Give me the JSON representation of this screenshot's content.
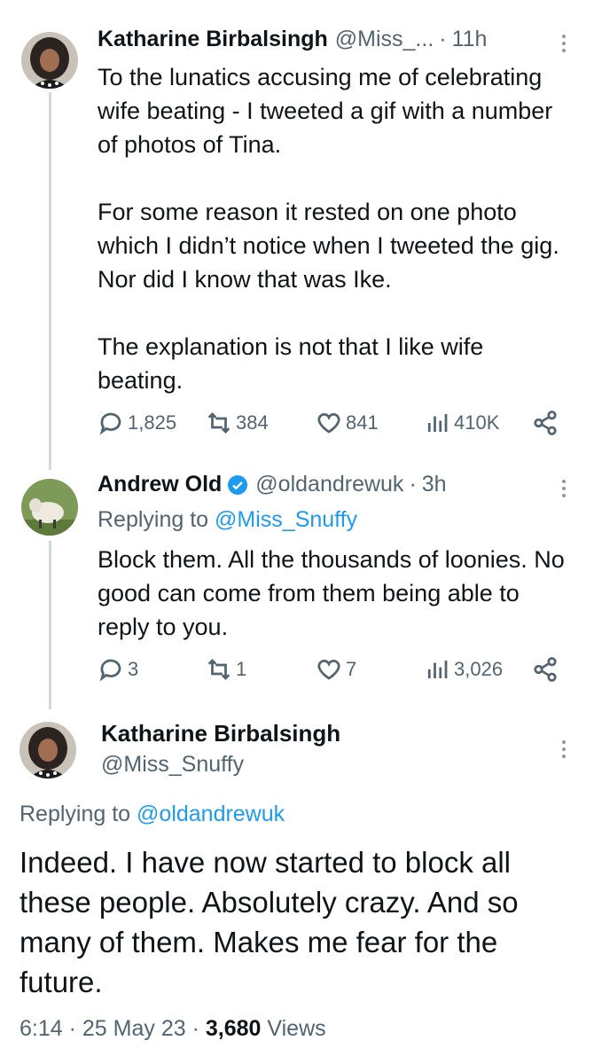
{
  "tweets": [
    {
      "name": "Katharine Birbalsingh",
      "handle": "@Miss_...",
      "time": "11h",
      "paragraphs": [
        "To the lunatics accusing me of celebrating wife beating - I tweeted a gif with a number of photos of Tina.",
        "For some reason it rested on one photo which I didn’t notice when I tweeted the gig. Nor did I know that was Ike.",
        "The explanation is not that I like wife beating."
      ],
      "actions": {
        "replies": "1,825",
        "retweets": "384",
        "likes": "841",
        "views": "410K"
      }
    },
    {
      "name": "Andrew Old",
      "handle": "@oldandrewuk",
      "time": "3h",
      "replying_label": "Replying to",
      "replying_to": "@Miss_Snuffy",
      "paragraphs": [
        "Block them. All the thousands of loonies. No good can come from them being able to reply to you."
      ],
      "actions": {
        "replies": "3",
        "retweets": "1",
        "likes": "7",
        "views": "3,026"
      }
    },
    {
      "name": "Katharine Birbalsingh",
      "handle": "@Miss_Snuffy",
      "replying_label": "Replying to",
      "replying_to": "@oldandrewuk",
      "text": "Indeed. I have now started to block all these people. Absolutely crazy. And so many of them. Makes me fear for the future.",
      "time": "6:14",
      "date": "25 May 23",
      "views_count": "3,680",
      "views_label": "Views"
    }
  ],
  "icons": [
    "reply-icon",
    "retweet-icon",
    "like-icon",
    "views-icon",
    "share-icon",
    "more-icon",
    "verified-icon"
  ],
  "colors": {
    "link": "#1d9bf0",
    "secondary": "#536471",
    "text": "#0f1419",
    "thread_line": "#cfd9de",
    "verified": "#1d9bf0"
  }
}
